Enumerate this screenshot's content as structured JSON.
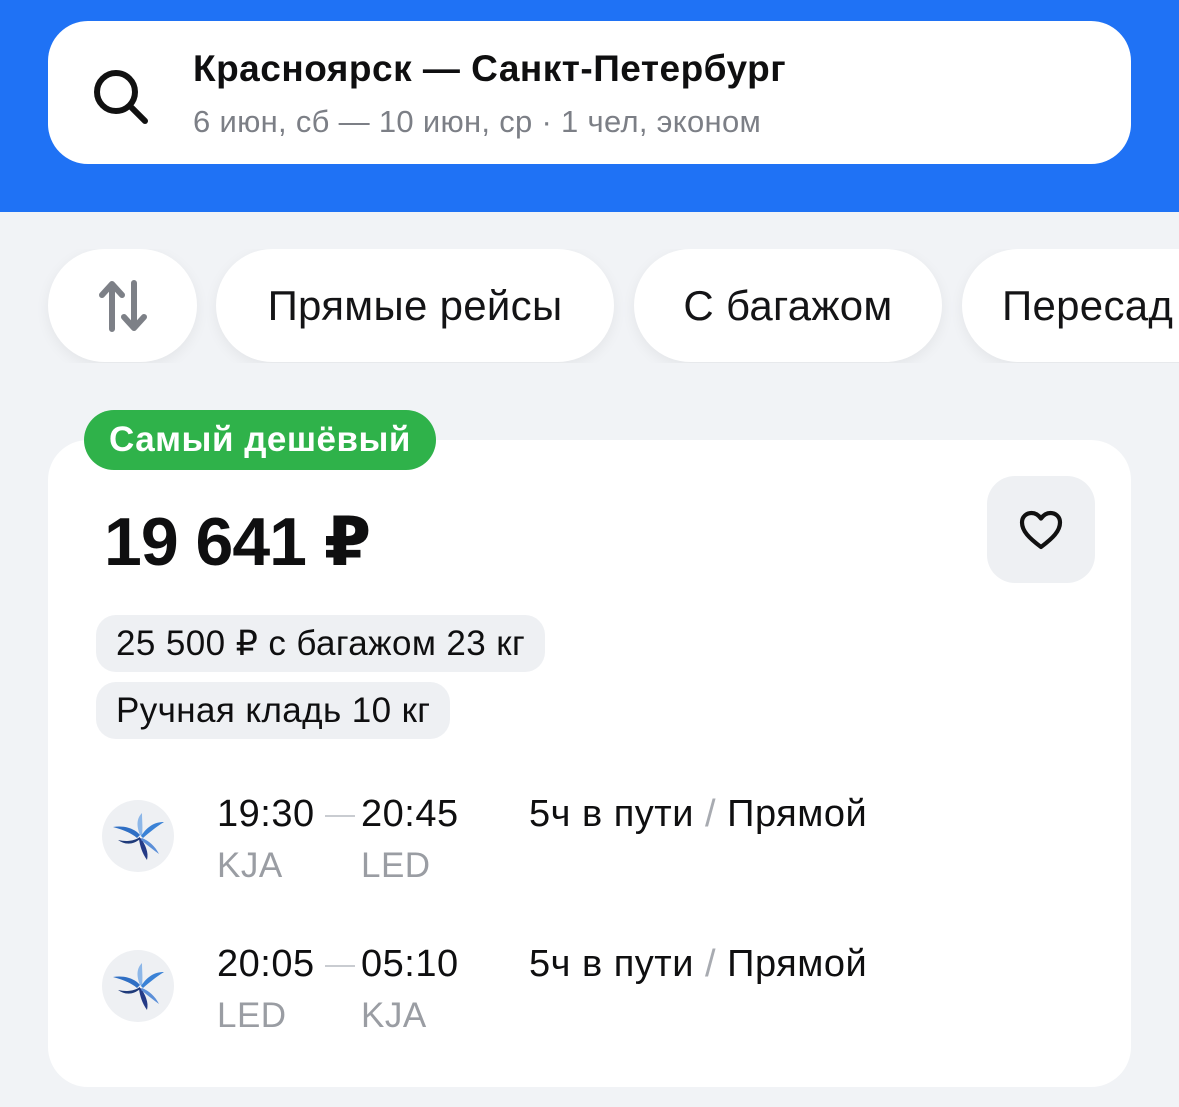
{
  "search": {
    "route": "Красноярск — Санкт-Петербург",
    "details": "6 июн, сб — 10 июн, ср · 1 чел, эконом"
  },
  "filters": {
    "sort_icon": "sort-arrows-icon",
    "chips": [
      "Прямые рейсы",
      "С багажом",
      "Пересад"
    ]
  },
  "offer": {
    "badge": "Самый дешёвый",
    "price": "19 641 ₽",
    "baggage_option": "25 500 ₽ с багажом 23 кг",
    "hand_luggage": "Ручная кладь 10 кг",
    "favorite_icon": "heart-icon",
    "legs": [
      {
        "dep_time": "19:30",
        "arr_time": "20:45",
        "dep_code": "KJA",
        "arr_code": "LED",
        "duration": "5ч в пути",
        "separator": "/",
        "type": "Прямой"
      },
      {
        "dep_time": "20:05",
        "arr_time": "05:10",
        "dep_code": "LED",
        "arr_code": "KJA",
        "duration": "5ч в пути",
        "separator": "/",
        "type": "Прямой"
      }
    ]
  },
  "colors": {
    "header_blue": "#1F72F5",
    "badge_green": "#2FB24A",
    "background": "#F1F3F6"
  }
}
